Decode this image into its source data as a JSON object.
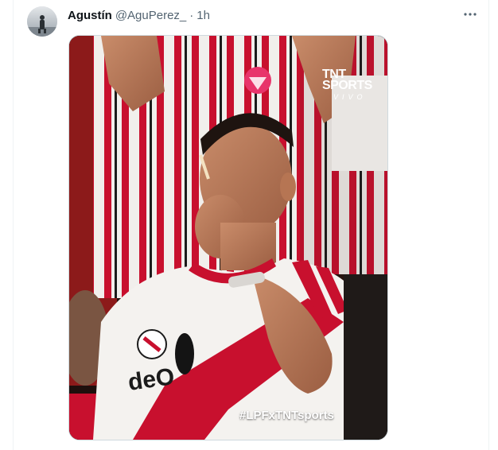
{
  "tweet": {
    "display_name": "Agustín",
    "handle": "@AguPerez_",
    "separator": "·",
    "time": "1h",
    "more_icon": "more-horizontal-icon"
  },
  "media": {
    "logo_line1": "TNT",
    "logo_line2": "SPORTS",
    "logo_line3": "VIVO",
    "hashtag": "#LPFxTNTsports",
    "shirt_text": "deO"
  },
  "colors": {
    "text_primary": "#0f1419",
    "text_secondary": "#536471",
    "border": "#cfd9de",
    "logo_pink": "#e8346b",
    "jersey_red": "#c8102e"
  }
}
